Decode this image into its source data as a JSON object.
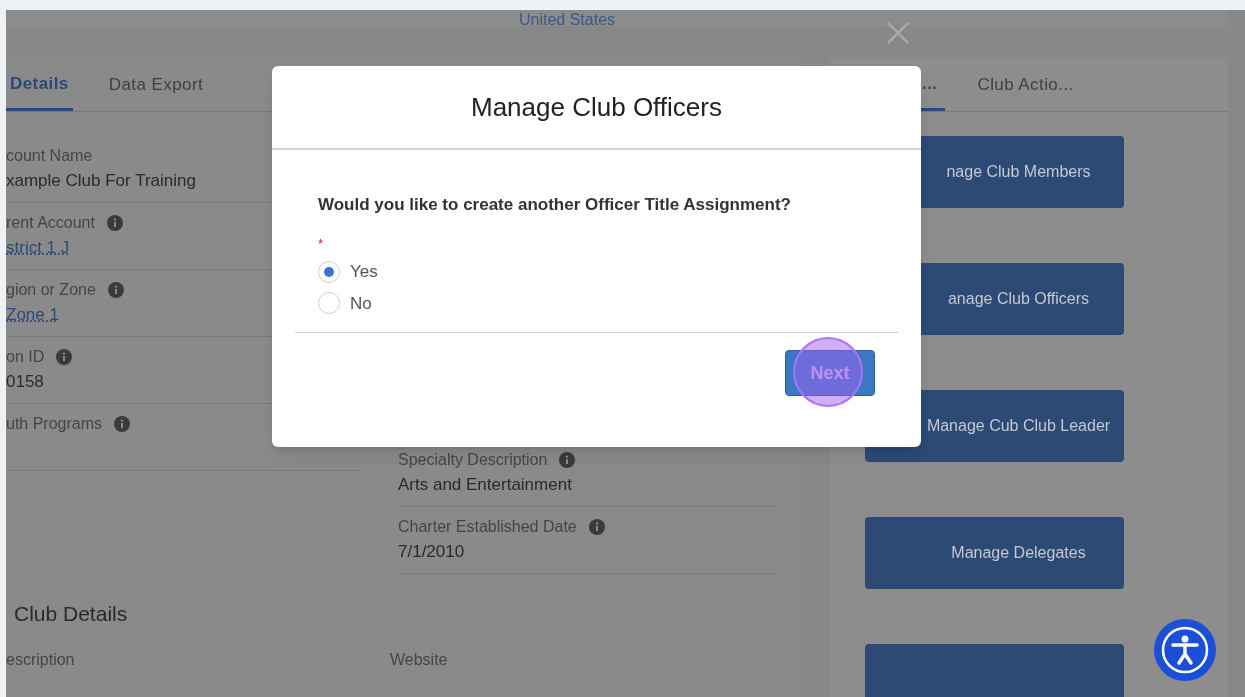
{
  "header": {
    "country": "United States"
  },
  "details_tabs": [
    {
      "label": "Details",
      "selected": true
    },
    {
      "label": "Data Export",
      "selected": false
    }
  ],
  "fields_left": [
    {
      "label": "count Name",
      "info": false,
      "value": "xample Club For Training",
      "kind": "text"
    },
    {
      "label": "rent Account",
      "info": true,
      "value": "strict 1 J",
      "kind": "link"
    },
    {
      "label": "gion or Zone",
      "info": true,
      "value": "Zone 1",
      "kind": "link"
    },
    {
      "label": "on ID",
      "info": true,
      "value": "0158",
      "kind": "text"
    },
    {
      "label": "uth Programs",
      "info": true
    }
  ],
  "fields_right": [
    {
      "label": "Specialty Description",
      "info": true,
      "value": "Arts and Entertainment",
      "kind": "text"
    },
    {
      "label": "Charter Established Date",
      "info": true,
      "value": "7/1/2010",
      "kind": "text"
    }
  ],
  "section": {
    "title": "Club Details",
    "label_left": "escription",
    "label_right": "Website"
  },
  "action_tabs": [
    {
      "label": "...",
      "selected": true
    },
    {
      "label": "Club Actio...",
      "selected": false
    }
  ],
  "actions": [
    {
      "label": "nage Club Members"
    },
    {
      "label": "anage Club Officers"
    },
    {
      "label": "Manage Cub Club Leader"
    },
    {
      "label": "Manage Delegates"
    }
  ],
  "modal": {
    "title": "Manage Club Officers",
    "question": "Would you like to create another Officer Title Assignment?",
    "required_mark": "*",
    "options": [
      {
        "label": "Yes",
        "selected": true
      },
      {
        "label": "No",
        "selected": false
      }
    ],
    "next_button": "Next"
  }
}
